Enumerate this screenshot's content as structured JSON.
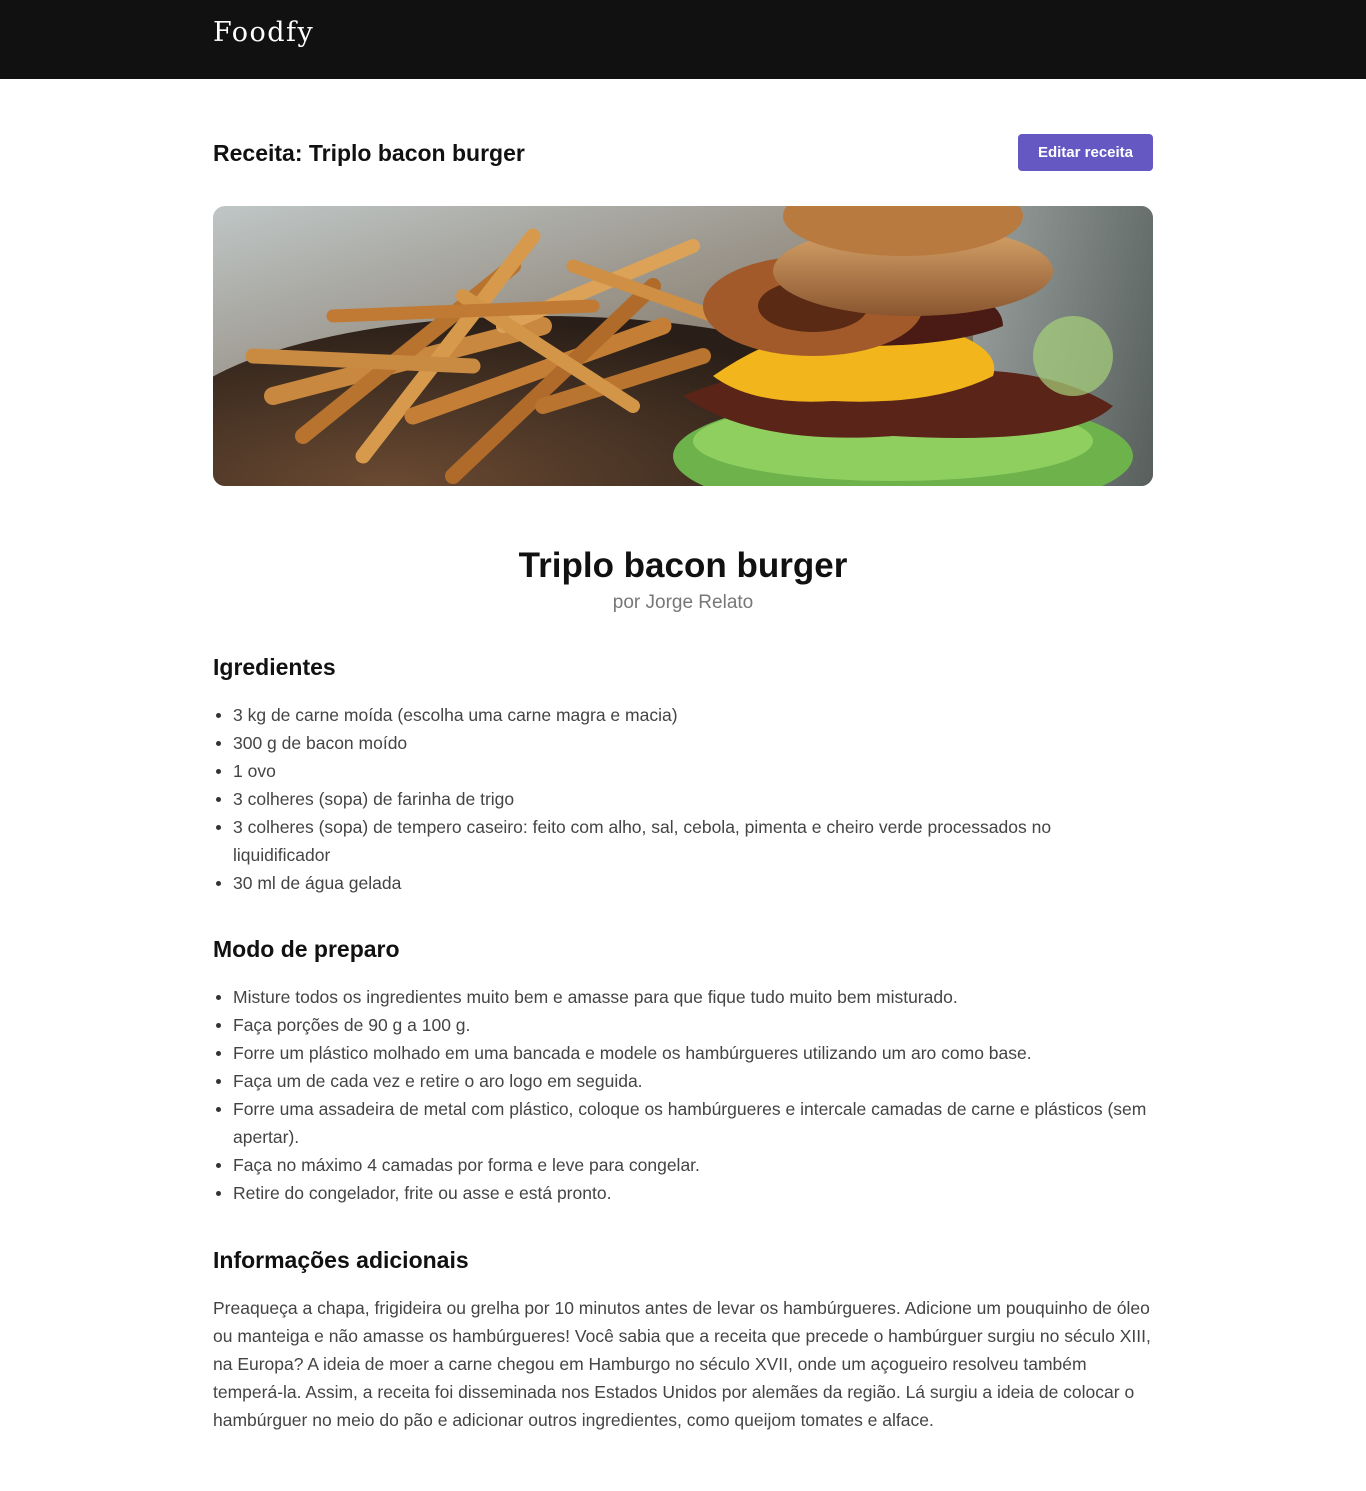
{
  "header": {
    "brand": "Foodfy"
  },
  "page": {
    "title": "Receita: Triplo bacon burger",
    "edit_button": "Editar receita"
  },
  "recipe": {
    "name": "Triplo bacon burger",
    "author": "por Jorge Relato",
    "ingredients_title": "Igredientes",
    "ingredients": [
      "3 kg de carne moída (escolha uma carne magra e macia)",
      "300 g de bacon moído",
      "1 ovo",
      "3 colheres (sopa) de farinha de trigo",
      "3 colheres (sopa) de tempero caseiro: feito com alho, sal, cebola, pimenta e cheiro verde processados no liquidificador",
      "30 ml de água gelada"
    ],
    "preparation_title": "Modo de preparo",
    "preparation": [
      "Misture todos os ingredientes muito bem e amasse para que fique tudo muito bem misturado.",
      "Faça porções de 90 g a 100 g.",
      "Forre um plástico molhado em uma bancada e modele os hambúrgueres utilizando um aro como base.",
      "Faça um de cada vez e retire o aro logo em seguida.",
      "Forre uma assadeira de metal com plástico, coloque os hambúrgueres e intercale camadas de carne e plásticos (sem apertar).",
      "Faça no máximo 4 camadas por forma e leve para congelar.",
      "Retire do congelador, frite ou asse e está pronto."
    ],
    "info_title": "Informações adicionais",
    "info": "Preaqueça a chapa, frigideira ou grelha por 10 minutos antes de levar os hambúrgueres. Adicione um pouquinho de óleo ou manteiga e não amasse os hambúrgueres! Você sabia que a receita que precede o hambúrguer surgiu no século XIII, na Europa? A ideia de moer a carne chegou em Hamburgo no século XVII, onde um açogueiro resolveu também temperá-la. Assim, a receita foi disseminada nos Estados Unidos por alemães da região. Lá surgiu a ideia de colocar o hambúrguer no meio do pão e adicionar outros ingredientes, como queijom tomates e alface."
  },
  "colors": {
    "topbar": "#111111",
    "accent": "#6558c3"
  }
}
